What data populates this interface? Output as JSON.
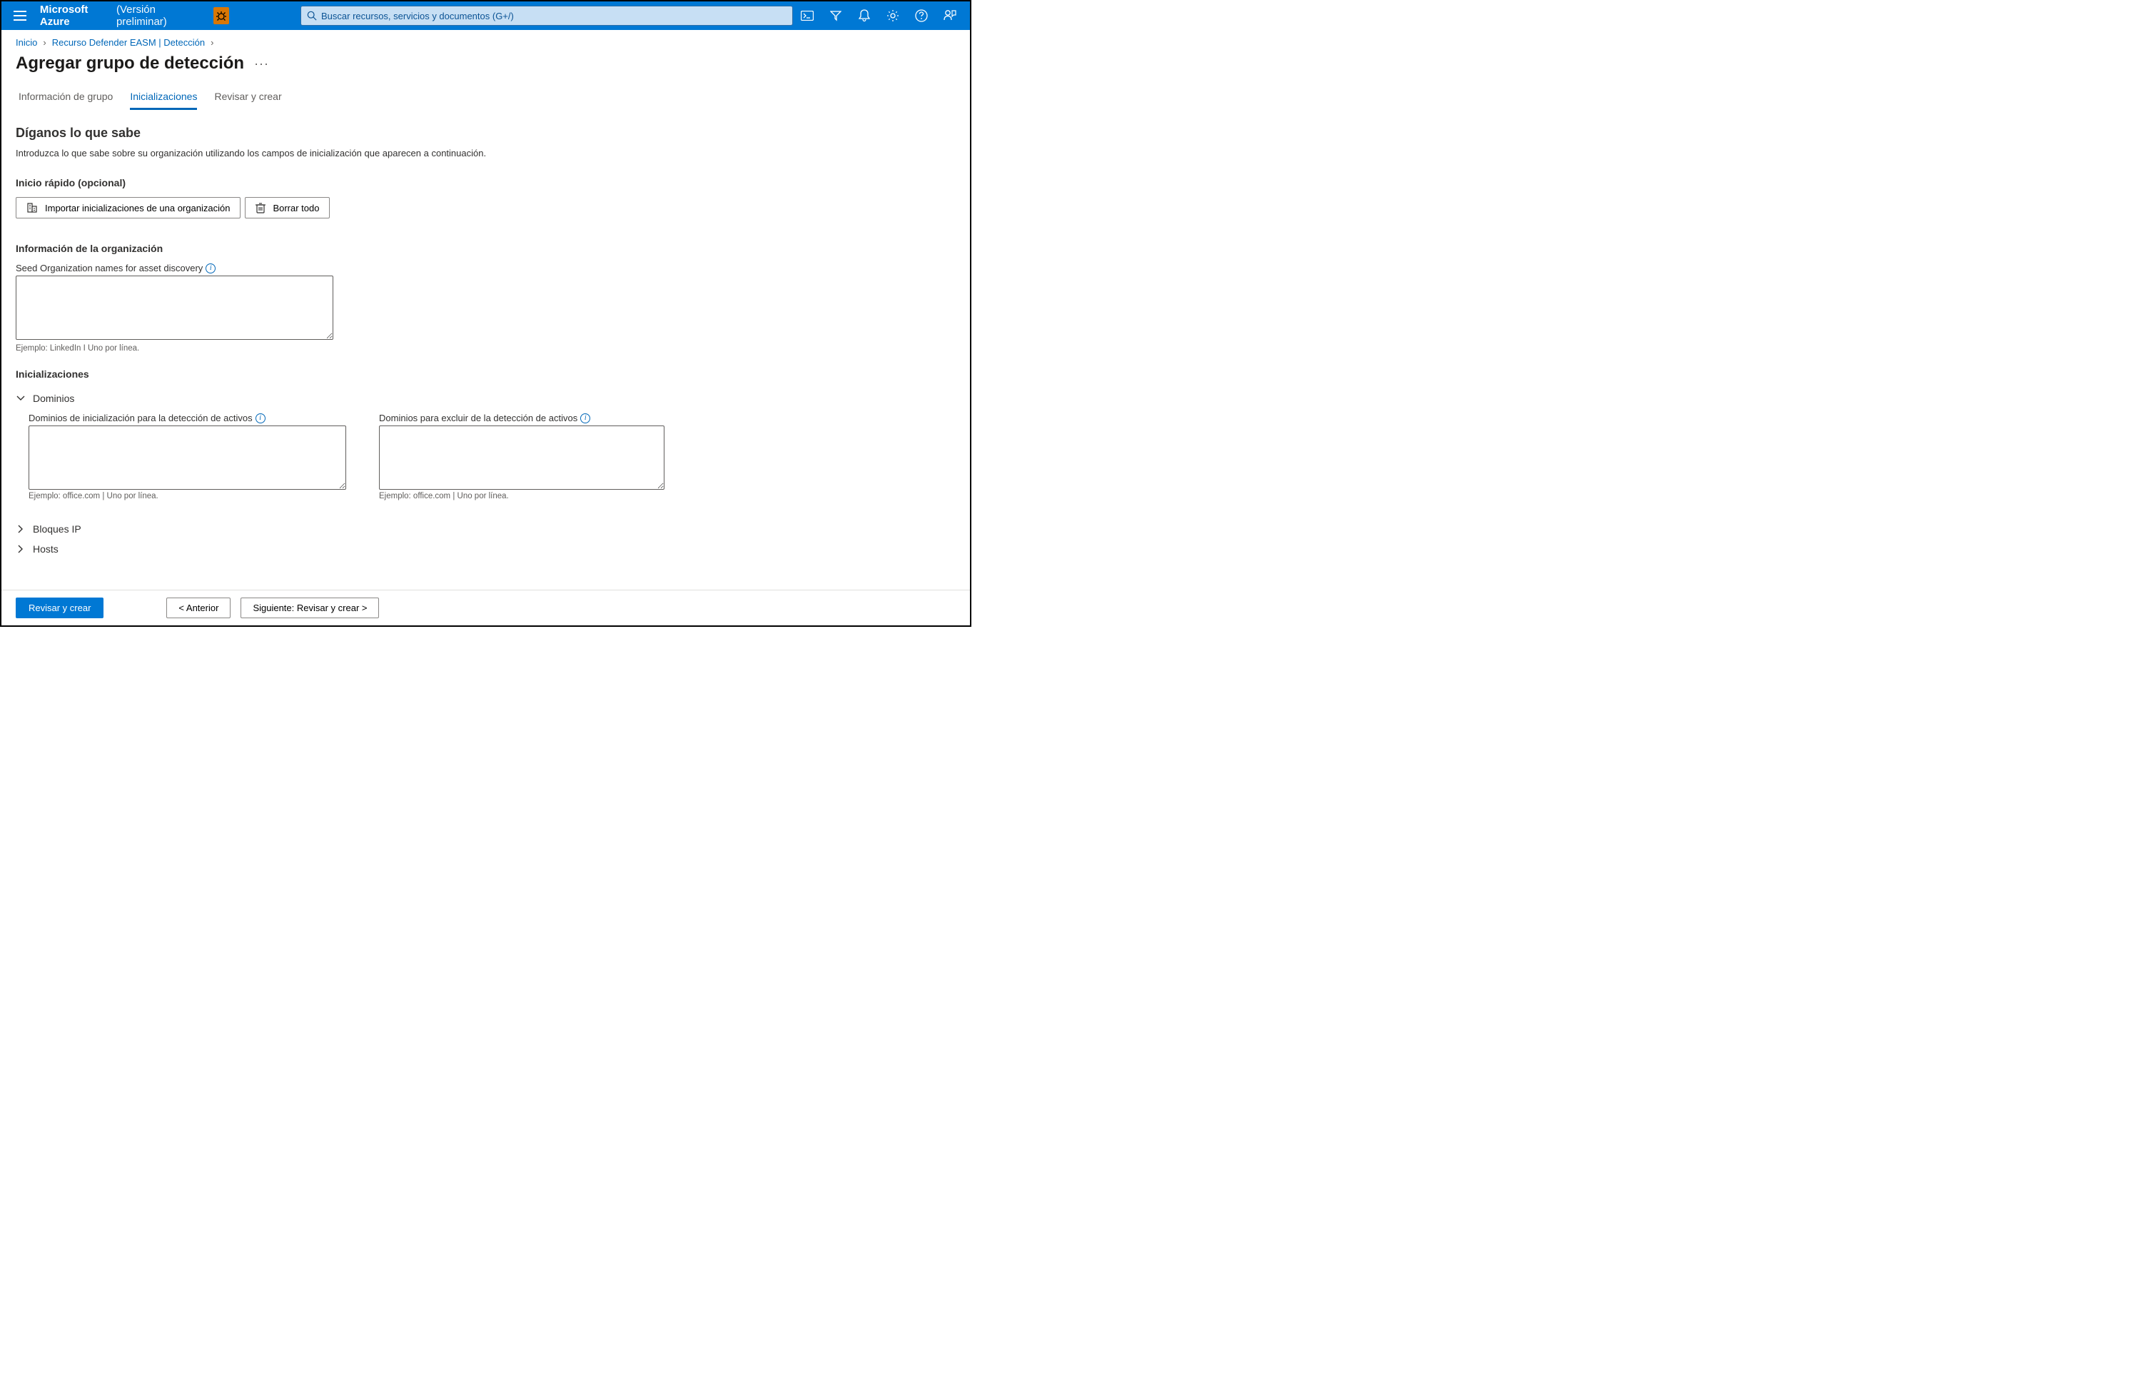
{
  "header": {
    "brand_name": "Microsoft Azure",
    "brand_preview": "(Versión preliminar)",
    "search_placeholder": "Buscar recursos, servicios y documentos (G+/)"
  },
  "breadcrumb": {
    "items": [
      "Inicio",
      "Recurso Defender EASM | Detección"
    ]
  },
  "page": {
    "title": "Agregar grupo de detección"
  },
  "tabs": {
    "items": [
      {
        "label": "Información de grupo",
        "active": false
      },
      {
        "label": "Inicializaciones",
        "active": true
      },
      {
        "label": "Revisar y crear",
        "active": false
      }
    ]
  },
  "intro": {
    "heading": "Díganos lo que sabe",
    "text": "Introduzca lo que sabe sobre su organización utilizando los campos de inicialización que aparecen a continuación."
  },
  "quickstart": {
    "heading": "Inicio rápido (opcional)",
    "import_label": "Importar inicializaciones de una organización",
    "clear_label": "Borrar todo"
  },
  "org_info": {
    "heading": "Información de la organización",
    "seed_label": "Seed Organization names for asset discovery",
    "seed_value": "",
    "seed_hint": "Ejemplo: LinkedIn I Uno por línea."
  },
  "seeds": {
    "heading": "Inicializaciones",
    "sections": [
      {
        "title": "Dominios",
        "expanded": true,
        "include_label": "Dominios de inicialización para la detección de activos",
        "include_value": "",
        "include_hint": "Ejemplo: office.com | Uno por línea.",
        "exclude_label": "Dominios para excluir de la detección de activos",
        "exclude_value": "",
        "exclude_hint": "Ejemplo: office.com | Uno por línea."
      },
      {
        "title": "Bloques IP",
        "expanded": false
      },
      {
        "title": "Hosts",
        "expanded": false
      }
    ]
  },
  "footer": {
    "review_label": "Revisar y crear",
    "prev_label": "< Anterior",
    "next_label": "Siguiente: Revisar y crear >"
  }
}
